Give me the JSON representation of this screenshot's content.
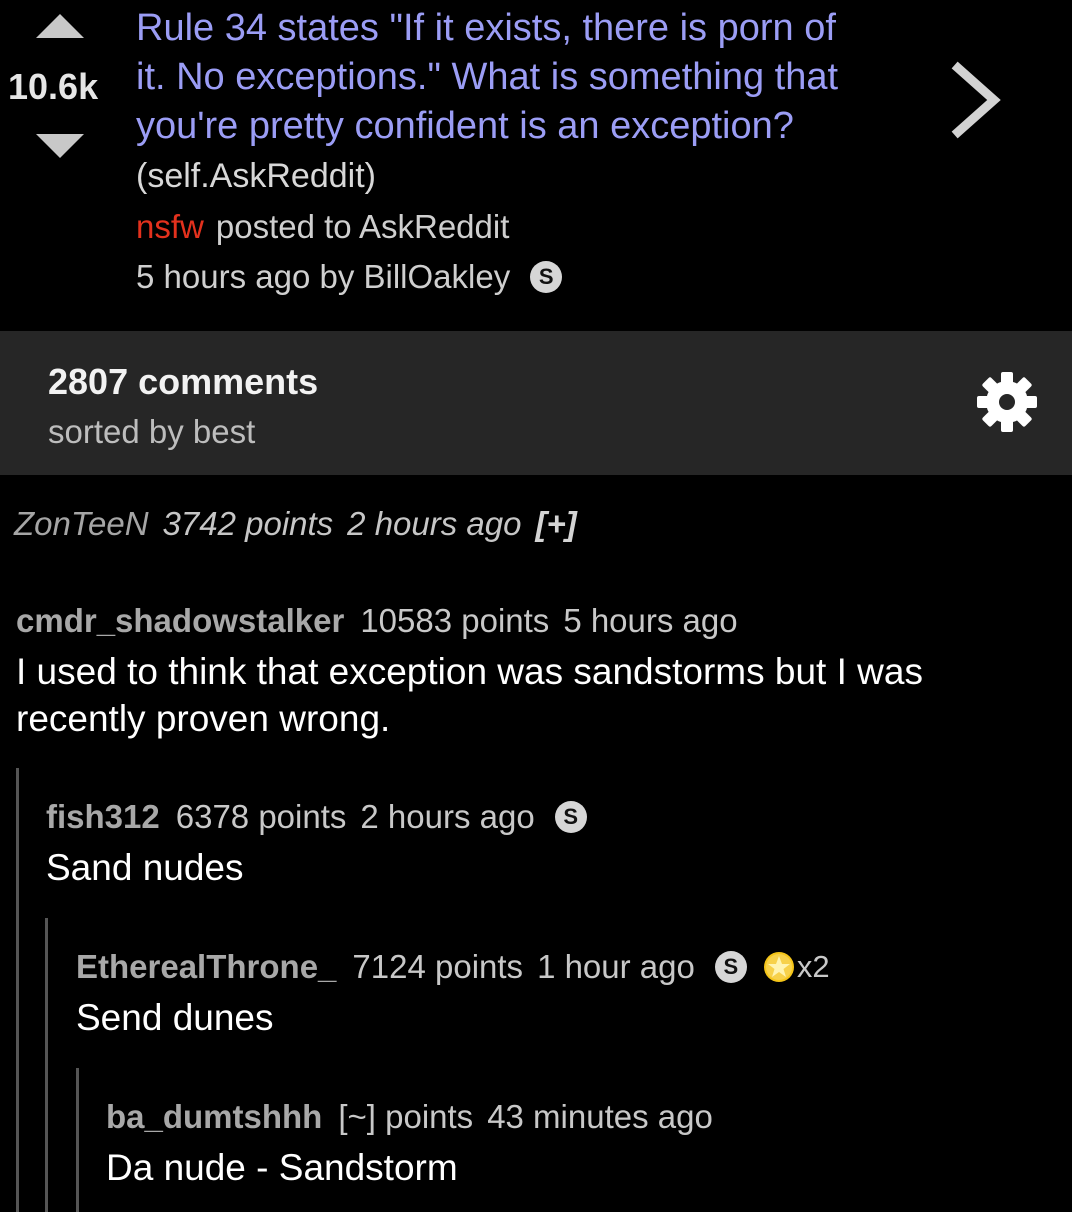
{
  "post": {
    "score": "10.6k",
    "title": "Rule 34 states \"If it exists, there is porn of it. No exceptions.\" What is something that you're pretty confident is an exception?",
    "domain": "(self.AskReddit)",
    "nsfw_label": "nsfw",
    "posted_to": "posted to AskReddit",
    "time_by": "5 hours ago by BillOakley",
    "badge": "S"
  },
  "comments_bar": {
    "count": "2807 comments",
    "sort": "sorted by best"
  },
  "collapsed_comment": {
    "author": "ZonTeeN",
    "points": "3742 points",
    "time": "2 hours ago",
    "toggle": "[+]"
  },
  "comments": [
    {
      "author": "cmdr_shadowstalker",
      "points": "10583 points",
      "time": "5 hours ago",
      "body": "I used to think that exception was sandstorms but I was recently proven wrong."
    },
    {
      "author": "fish312",
      "points": "6378 points",
      "time": "2 hours ago",
      "badge": "S",
      "body": "Sand nudes"
    },
    {
      "author": "EtherealThrone_",
      "points": "7124 points",
      "time": "1 hour ago",
      "badge": "S",
      "gild_count": "x2",
      "body": "Send dunes"
    },
    {
      "author": "ba_dumtshhh",
      "points": "[~] points",
      "time": "43 minutes ago",
      "body": "Da nude - Sandstorm"
    }
  ],
  "icons": {
    "upvote": "upvote-arrow-icon",
    "downvote": "downvote-arrow-icon",
    "chevron": "chevron-right-icon",
    "settings": "gear-icon",
    "gild": "gold-star-icon"
  },
  "colors": {
    "title": "#9b9df5",
    "nsfw": "#e3311d",
    "bar": "#262626",
    "gild": "#f5c518"
  }
}
